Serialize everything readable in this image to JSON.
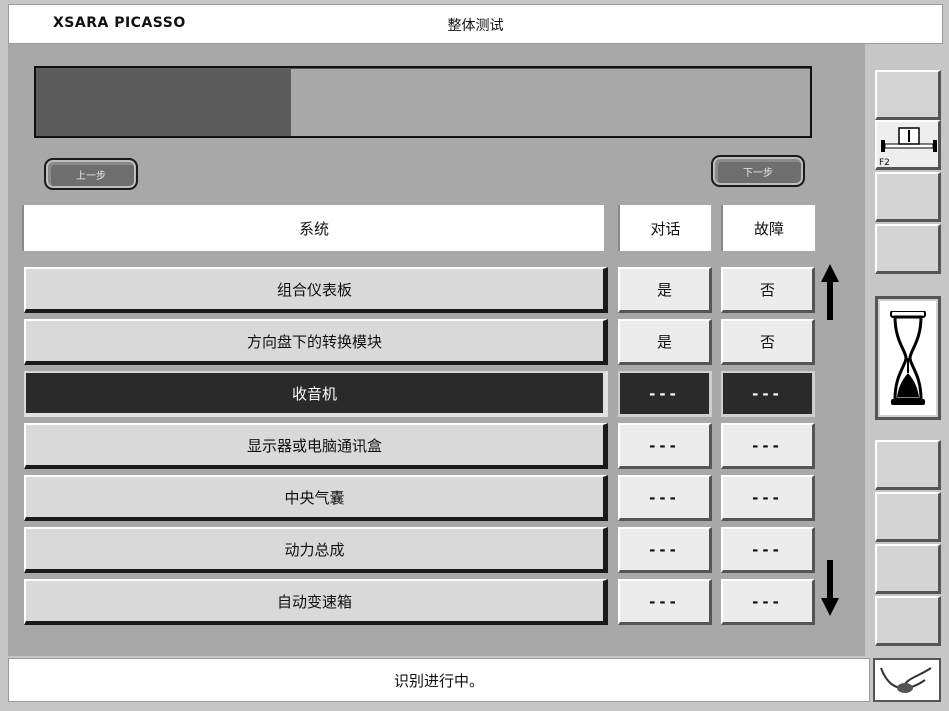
{
  "header": {
    "app_name": "XSARA PICASSO",
    "screen_title": "整体测试"
  },
  "progress": {
    "fraction": 0.33
  },
  "nav": {
    "prev_label": "上一步",
    "next_label": "下一步"
  },
  "table": {
    "columns": [
      "系统",
      "对话",
      "故障"
    ],
    "rows": [
      {
        "system": "组合仪表板",
        "dialog": "是",
        "fault": "否",
        "selected": false
      },
      {
        "system": "方向盘下的转换模块",
        "dialog": "是",
        "fault": "否",
        "selected": false
      },
      {
        "system": "收音机",
        "dialog": "---",
        "fault": "---",
        "selected": true
      },
      {
        "system": "显示器或电脑通讯盒",
        "dialog": "---",
        "fault": "---",
        "selected": false
      },
      {
        "system": "中央气囊",
        "dialog": "---",
        "fault": "---",
        "selected": false
      },
      {
        "system": "动力总成",
        "dialog": "---",
        "fault": "---",
        "selected": false
      },
      {
        "system": "自动变速箱",
        "dialog": "---",
        "fault": "---",
        "selected": false
      }
    ]
  },
  "toolbar": {
    "f2_label": "F2"
  },
  "status": {
    "text": "识别进行中。"
  },
  "colors": {
    "panel": "#a8a8a8",
    "progress_fill": "#5c5c5c",
    "selected_row": "#2a2a2a"
  }
}
